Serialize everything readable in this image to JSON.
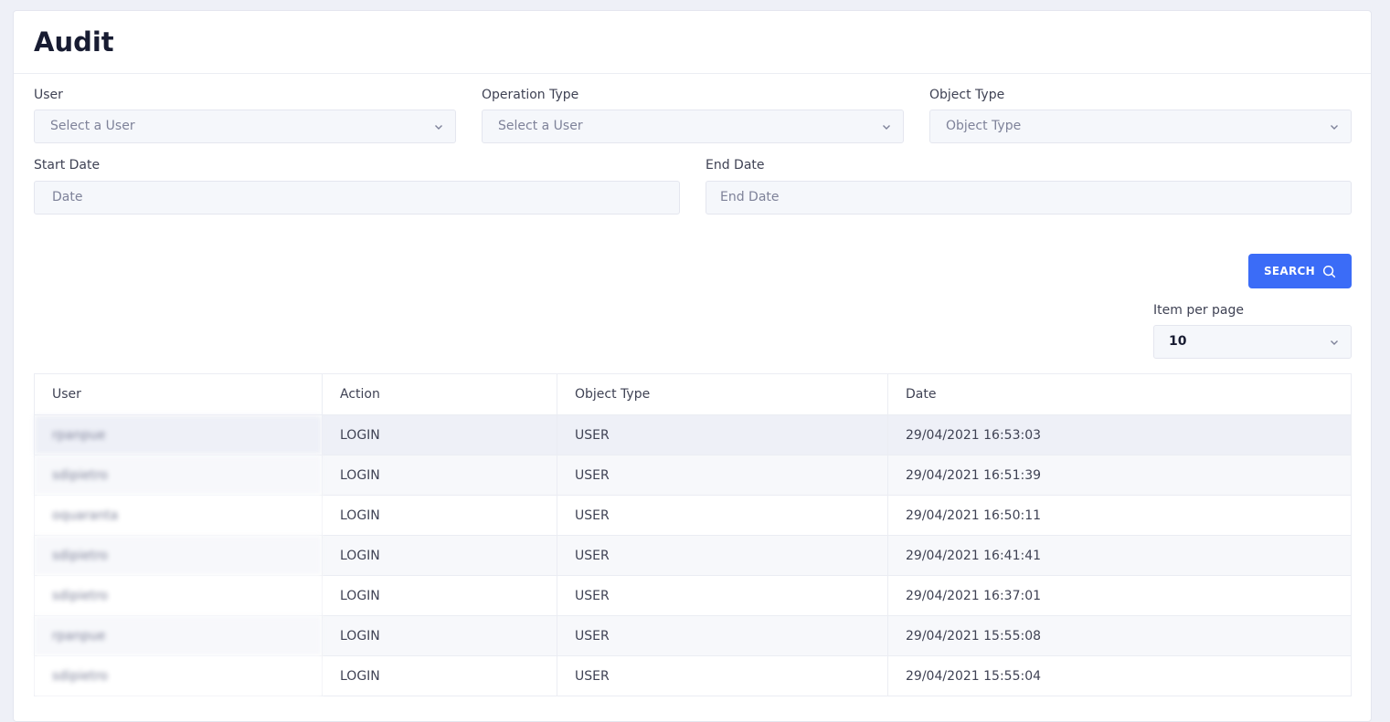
{
  "page": {
    "title": "Audit"
  },
  "filters": {
    "user": {
      "label": "User",
      "placeholder": "Select a User"
    },
    "operation_type": {
      "label": "Operation Type",
      "placeholder": "Select a User"
    },
    "object_type": {
      "label": "Object Type",
      "placeholder": "Object Type"
    },
    "start_date": {
      "label": "Start Date",
      "placeholder": "Date"
    },
    "end_date": {
      "label": "End Date",
      "placeholder": "End Date"
    }
  },
  "search_button": {
    "label": "SEARCH",
    "icon": "search-icon"
  },
  "pagination": {
    "label": "Item per page",
    "value": "10"
  },
  "table": {
    "columns": [
      "User",
      "Action",
      "Object Type",
      "Date"
    ],
    "rows": [
      {
        "user": "rpanpue",
        "action": "LOGIN",
        "object_type": "USER",
        "date": "29/04/2021 16:53:03"
      },
      {
        "user": "sdipietro",
        "action": "LOGIN",
        "object_type": "USER",
        "date": "29/04/2021 16:51:39"
      },
      {
        "user": "oquaranta",
        "action": "LOGIN",
        "object_type": "USER",
        "date": "29/04/2021 16:50:11"
      },
      {
        "user": "sdipietro",
        "action": "LOGIN",
        "object_type": "USER",
        "date": "29/04/2021 16:41:41"
      },
      {
        "user": "sdipietro",
        "action": "LOGIN",
        "object_type": "USER",
        "date": "29/04/2021 16:37:01"
      },
      {
        "user": "rpanpue",
        "action": "LOGIN",
        "object_type": "USER",
        "date": "29/04/2021 15:55:08"
      },
      {
        "user": "sdipietro",
        "action": "LOGIN",
        "object_type": "USER",
        "date": "29/04/2021 15:55:04"
      }
    ]
  },
  "colors": {
    "accent": "#3b6cf7",
    "background": "#eef0f7",
    "title": "#181c32"
  }
}
